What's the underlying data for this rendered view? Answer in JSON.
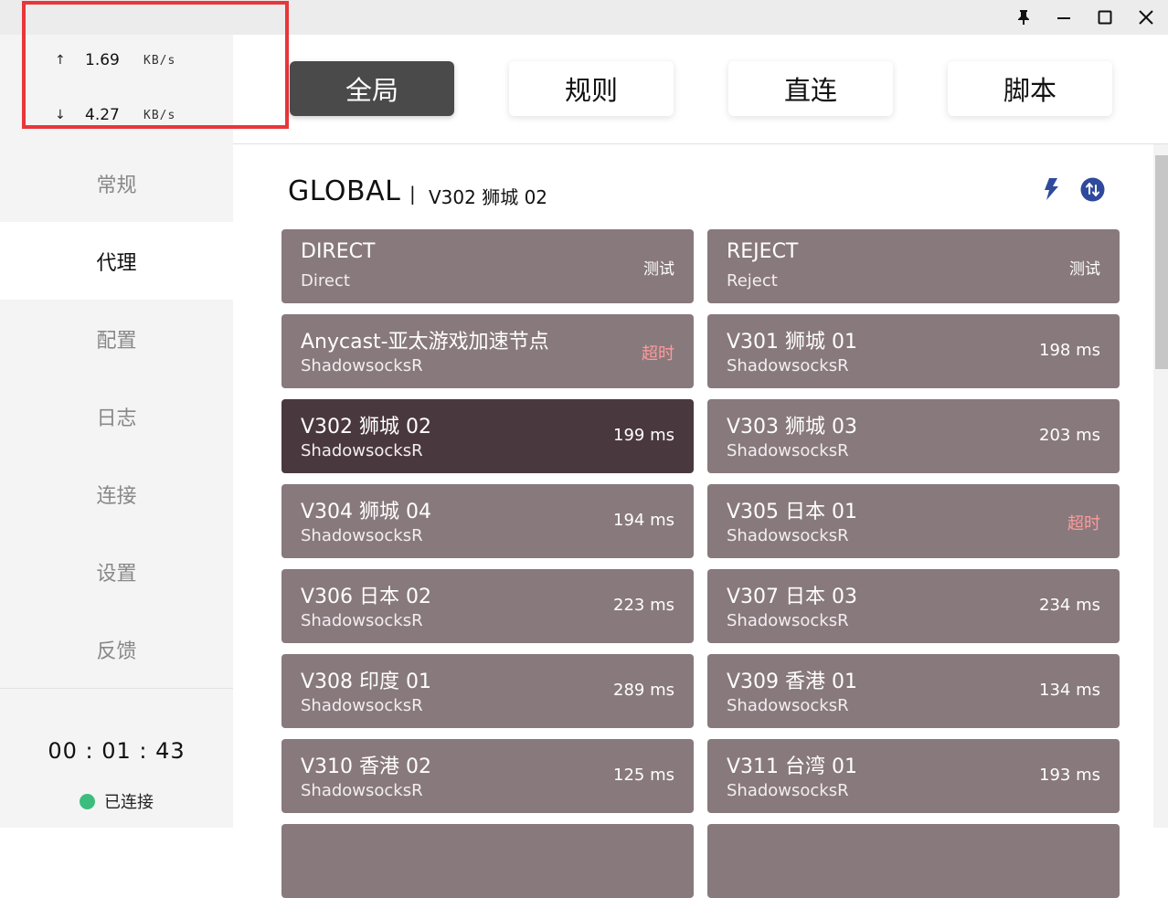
{
  "titlebar": {
    "buttons": [
      "pin-icon",
      "minimize-icon",
      "maximize-icon",
      "close-icon"
    ]
  },
  "traffic": {
    "up_arrow": "↑",
    "up_value": "1.69",
    "up_unit": "KB/s",
    "down_arrow": "↓",
    "down_value": "4.27",
    "down_unit": "KB/s",
    "highlight_color": "#e8363a"
  },
  "sidebar": {
    "items": [
      {
        "label": "常规"
      },
      {
        "label": "代理"
      },
      {
        "label": "配置"
      },
      {
        "label": "日志"
      },
      {
        "label": "连接"
      },
      {
        "label": "设置"
      },
      {
        "label": "反馈"
      }
    ],
    "active_index": 1,
    "timer": "00 : 01 : 43",
    "status_label": "已连接",
    "status_color": "#3dbd7d"
  },
  "modes": {
    "items": [
      {
        "label": "全局"
      },
      {
        "label": "规则"
      },
      {
        "label": "直连"
      },
      {
        "label": "脚本"
      }
    ],
    "active_index": 0
  },
  "group": {
    "name": "GLOBAL",
    "separator": "|",
    "selected": "V302 狮城 02",
    "icons": [
      "lightning-icon",
      "switch-icon"
    ]
  },
  "proxies": [
    {
      "name": "DIRECT",
      "type": "Direct",
      "delay": "测试",
      "state": "test"
    },
    {
      "name": "REJECT",
      "type": "Reject",
      "delay": "测试",
      "state": "test"
    },
    {
      "name": "Anycast-亚太游戏加速节点",
      "type": "ShadowsocksR",
      "delay": "超时",
      "state": "timeout"
    },
    {
      "name": "V301 狮城 01",
      "type": "ShadowsocksR",
      "delay": "198 ms",
      "state": "ok"
    },
    {
      "name": "V302 狮城 02",
      "type": "ShadowsocksR",
      "delay": "199 ms",
      "state": "ok",
      "selected": true
    },
    {
      "name": "V303 狮城 03",
      "type": "ShadowsocksR",
      "delay": "203 ms",
      "state": "ok"
    },
    {
      "name": "V304 狮城 04",
      "type": "ShadowsocksR",
      "delay": "194 ms",
      "state": "ok"
    },
    {
      "name": "V305 日本 01",
      "type": "ShadowsocksR",
      "delay": "超时",
      "state": "timeout"
    },
    {
      "name": "V306 日本 02",
      "type": "ShadowsocksR",
      "delay": "223 ms",
      "state": "ok"
    },
    {
      "name": "V307 日本 03",
      "type": "ShadowsocksR",
      "delay": "234 ms",
      "state": "ok"
    },
    {
      "name": "V308 印度 01",
      "type": "ShadowsocksR",
      "delay": "289 ms",
      "state": "ok"
    },
    {
      "name": "V309 香港 01",
      "type": "ShadowsocksR",
      "delay": "134 ms",
      "state": "ok"
    },
    {
      "name": "V310 香港 02",
      "type": "ShadowsocksR",
      "delay": "125 ms",
      "state": "ok"
    },
    {
      "name": "V311 台湾 01",
      "type": "ShadowsocksR",
      "delay": "193 ms",
      "state": "ok"
    }
  ],
  "colors": {
    "card": "#88797d",
    "card_selected": "#4a383f",
    "timeout": "#ff9a9a",
    "mode_active": "#4a4a4a",
    "accent_blue": "#2f4a9c"
  }
}
